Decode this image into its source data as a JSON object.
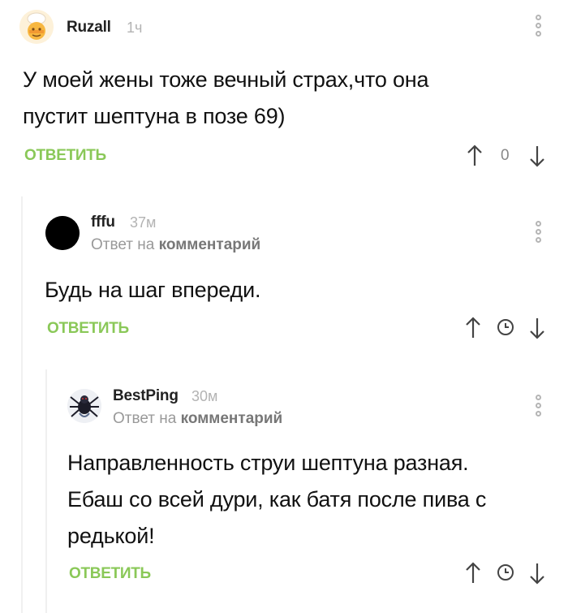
{
  "comments": [
    {
      "author": "Ruzall",
      "time": "1ч",
      "text_lines": [
        "У моей жены тоже вечный страх,что она",
        "пустит шептуна в позе 69)"
      ],
      "reply_label": "ОТВЕТИТЬ",
      "score": "0",
      "avatar_icon": "chef-face-avatar"
    },
    {
      "author": "fffu",
      "time": "37м",
      "reply_prefix": "Ответ на",
      "reply_target": "комментарий",
      "text_lines": [
        "Будь на шаг впереди."
      ],
      "reply_label": "ОТВЕТИТЬ",
      "avatar_icon": "black-circle-avatar"
    },
    {
      "author": "BestPing",
      "time": "30м",
      "reply_prefix": "Ответ на",
      "reply_target": "комментарий",
      "text_lines": [
        "Направленность струи шептуна разная.",
        "Ебаш со всей дури, как батя после пива с",
        "редькой!"
      ],
      "reply_label": "ОТВЕТИТЬ",
      "avatar_icon": "spider-avatar"
    }
  ],
  "colors": {
    "accent_green": "#8ac858",
    "thread_line": "#f0f0f0",
    "muted": "#b3b3b3"
  }
}
